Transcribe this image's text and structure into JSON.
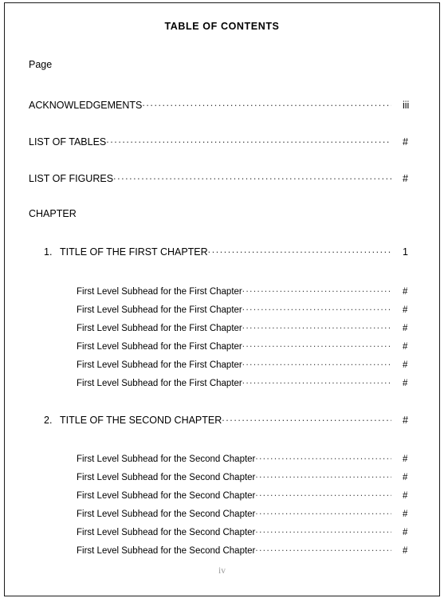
{
  "document": {
    "title": "TABLE OF CONTENTS",
    "page_column_label": "Page",
    "folio": "iv"
  },
  "front_matter": [
    {
      "label": "ACKNOWLEDGEMENTS",
      "page": "iii"
    },
    {
      "label": "LIST OF TABLES",
      "page": "#"
    },
    {
      "label": "LIST OF FIGURES",
      "page": "#"
    }
  ],
  "chapter_section_heading": "CHAPTER",
  "chapters": [
    {
      "number": "1.",
      "title": "TITLE OF THE FIRST CHAPTER",
      "page": "1",
      "subheads": [
        {
          "label": "First Level Subhead for the First Chapter ",
          "page": "#"
        },
        {
          "label": "First Level Subhead for the First Chapter ",
          "page": "#"
        },
        {
          "label": "First Level Subhead for the First Chapter ",
          "page": "#"
        },
        {
          "label": "First Level Subhead for the First Chapter ",
          "page": "#"
        },
        {
          "label": "First Level Subhead for the First Chapter ",
          "page": "#"
        },
        {
          "label": "First Level Subhead for the First Chapter ",
          "page": "#"
        }
      ]
    },
    {
      "number": "2.",
      "title": "TITLE OF THE SECOND CHAPTER",
      "page": "#",
      "subheads": [
        {
          "label": "First Level Subhead for the Second Chapter",
          "page": "#"
        },
        {
          "label": "First Level Subhead for the Second Chapter",
          "page": "#"
        },
        {
          "label": "First Level Subhead for the Second Chapter",
          "page": "#"
        },
        {
          "label": "First Level Subhead for the Second Chapter",
          "page": "#"
        },
        {
          "label": "First Level Subhead for the Second Chapter",
          "page": "#"
        },
        {
          "label": "First Level Subhead for the Second Chapter",
          "page": "#"
        }
      ]
    }
  ],
  "colors": {
    "text": "#000000",
    "leader": "#3a3a3a",
    "folio": "#9a9a9a",
    "frame": "#1a1a1a",
    "background": "#ffffff"
  }
}
